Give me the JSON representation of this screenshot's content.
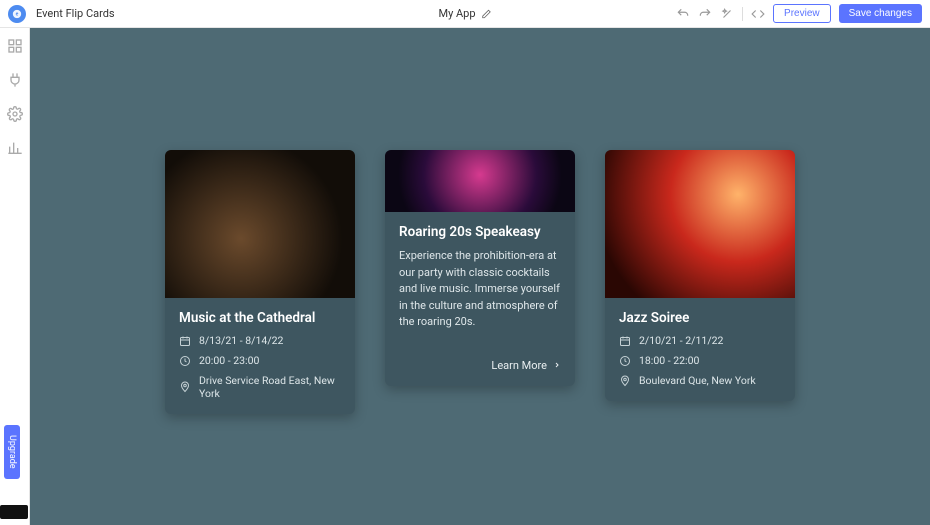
{
  "topbar": {
    "page_title": "Event Flip Cards",
    "app_name": "My App",
    "preview_label": "Preview",
    "save_label": "Save changes"
  },
  "upgrade_label": "Upgrade",
  "cards": [
    {
      "title": "Music at the Cathedral",
      "date": "8/13/21 - 8/14/22",
      "time": "20:00 - 23:00",
      "location": "Drive Service Road East, New York"
    },
    {
      "title": "Roaring 20s Speakeasy",
      "description": "Experience the prohibition-era at our party with classic cocktails and live music. Immerse yourself in the culture and atmosphere of the roaring 20s.",
      "learn_more": "Learn More"
    },
    {
      "title": "Jazz Soiree",
      "date": "2/10/21 - 2/11/22",
      "time": "18:00 - 22:00",
      "location": "Boulevard Que, New York"
    }
  ]
}
